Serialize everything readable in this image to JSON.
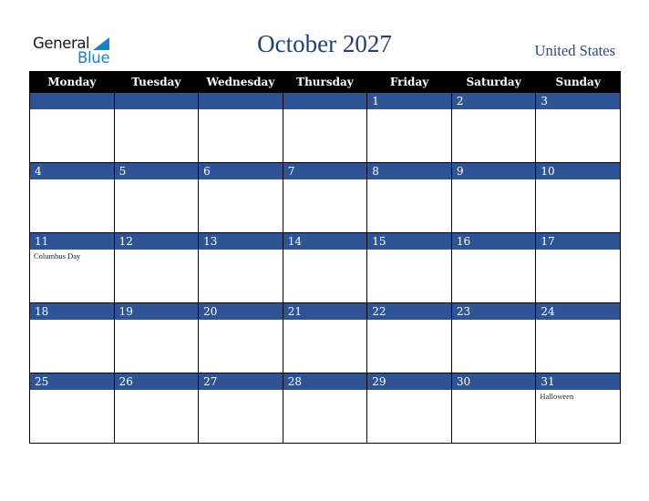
{
  "logo": {
    "line1": "General",
    "line2": "Blue",
    "accent_color": "#1f7fc4"
  },
  "header": {
    "title": "October 2027",
    "country": "United States"
  },
  "colors": {
    "title": "#24406e",
    "week_band": "#2e5496",
    "header_bg": "#000000"
  },
  "weekdays": [
    "Monday",
    "Tuesday",
    "Wednesday",
    "Thursday",
    "Friday",
    "Saturday",
    "Sunday"
  ],
  "weeks": [
    [
      {
        "day": ""
      },
      {
        "day": ""
      },
      {
        "day": ""
      },
      {
        "day": ""
      },
      {
        "day": "1"
      },
      {
        "day": "2"
      },
      {
        "day": "3"
      }
    ],
    [
      {
        "day": "4"
      },
      {
        "day": "5"
      },
      {
        "day": "6"
      },
      {
        "day": "7"
      },
      {
        "day": "8"
      },
      {
        "day": "9"
      },
      {
        "day": "10"
      }
    ],
    [
      {
        "day": "11",
        "holiday": "Columbus Day"
      },
      {
        "day": "12"
      },
      {
        "day": "13"
      },
      {
        "day": "14"
      },
      {
        "day": "15"
      },
      {
        "day": "16"
      },
      {
        "day": "17"
      }
    ],
    [
      {
        "day": "18"
      },
      {
        "day": "19"
      },
      {
        "day": "20"
      },
      {
        "day": "21"
      },
      {
        "day": "22"
      },
      {
        "day": "23"
      },
      {
        "day": "24"
      }
    ],
    [
      {
        "day": "25"
      },
      {
        "day": "26"
      },
      {
        "day": "27"
      },
      {
        "day": "28"
      },
      {
        "day": "29"
      },
      {
        "day": "30"
      },
      {
        "day": "31",
        "holiday": "Halloween"
      }
    ]
  ]
}
